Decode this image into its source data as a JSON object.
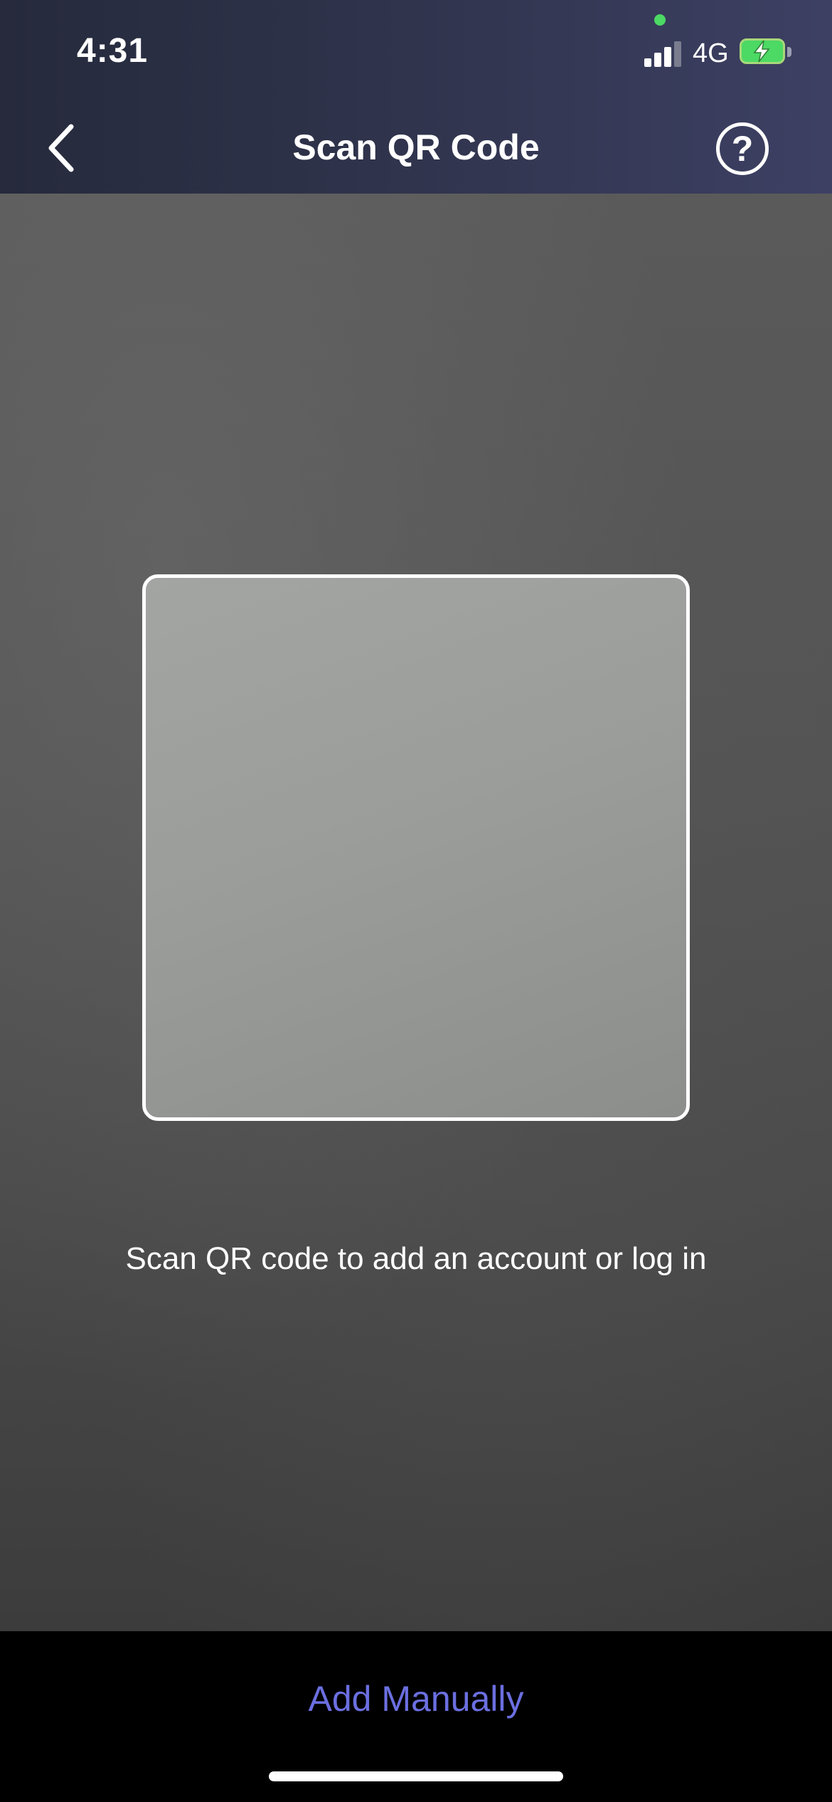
{
  "status_bar": {
    "time": "4:31",
    "network": "4G",
    "signal_bars_active": 3,
    "battery_charging": true,
    "privacy_indicator_color": "#4cd964"
  },
  "header": {
    "title": "Scan QR Code",
    "back_icon": "chevron-left-icon",
    "help_label": "?",
    "help_icon": "question-circle-icon"
  },
  "scanner": {
    "hint": "Scan QR code to add an account or log in"
  },
  "footer": {
    "add_manually_label": "Add Manually",
    "accent_color": "#6b6fe0"
  }
}
